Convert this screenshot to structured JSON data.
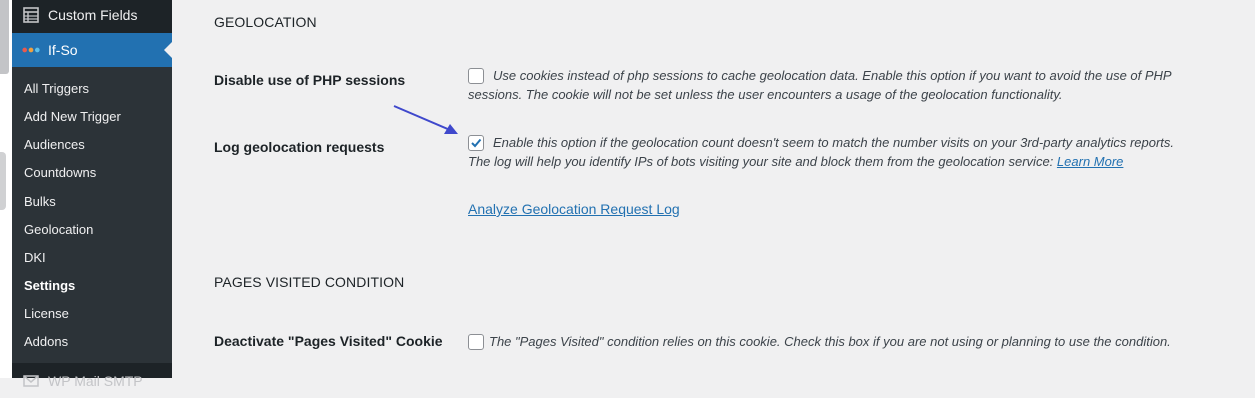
{
  "sidebar": {
    "custom_fields": "Custom Fields",
    "plugin_name": "If-So",
    "items": [
      {
        "label": "All Triggers"
      },
      {
        "label": "Add New Trigger"
      },
      {
        "label": "Audiences"
      },
      {
        "label": "Countdowns"
      },
      {
        "label": "Bulks"
      },
      {
        "label": "Geolocation"
      },
      {
        "label": "DKI"
      },
      {
        "label": "Settings",
        "current": true
      },
      {
        "label": "License"
      },
      {
        "label": "Addons"
      }
    ],
    "next_menu": "WP Mail SMTP"
  },
  "geolocation": {
    "heading": "GEOLOCATION",
    "disable_sessions": {
      "label": "Disable use of PHP sessions",
      "checked": false,
      "desc_line1": "Use cookies instead of php sessions to cache geolocation data. Enable this option if you want to avoid the use of PHP",
      "desc_line2": "sessions. The cookie will not be set unless the user encounters a usage of the geolocation functionality."
    },
    "log_requests": {
      "label": "Log geolocation requests",
      "checked": true,
      "desc_line1": "Enable this option if the geolocation count doesn't seem to match the number visits on your 3rd-party analytics reports.",
      "desc_line2": "The log will help you identify IPs of bots visiting your site and block them from the geolocation service:",
      "learn_more": "Learn More"
    },
    "analyze_link": "Analyze Geolocation Request Log"
  },
  "pages_visited": {
    "heading": "PAGES VISITED CONDITION",
    "deactivate_cookie": {
      "label": "Deactivate \"Pages Visited\" Cookie",
      "checked": false,
      "desc": "The \"Pages Visited\" condition relies on this cookie. Check this box if you are not using or planning to use the condition."
    }
  },
  "colors": {
    "sidebar_bg": "#1d2327",
    "submenu_bg": "#2c3338",
    "accent": "#2271b1",
    "page_bg": "#f0f0f1",
    "arrow": "#3f48cc"
  }
}
